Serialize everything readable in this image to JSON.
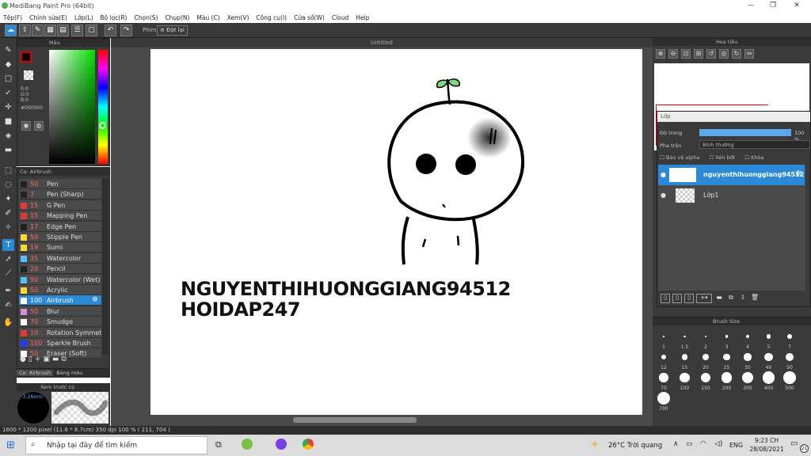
{
  "window": {
    "title": "MediBang Paint Pro (64bit)"
  },
  "menu": [
    "Tệp(F)",
    "Chỉnh sửa(E)",
    "Lớp(L)",
    "Bộ lọc(R)",
    "Chọn(S)",
    "Chụp(N)",
    "Màu (C)",
    "Xem(V)",
    "Công cụ(I)",
    "Cửa sổ(W)",
    "Cloud",
    "Help"
  ],
  "toolbar": {
    "filter_label": "Phím",
    "reset_label": "Đặt lại"
  },
  "color_panel": {
    "title": "Màu",
    "r": "R:0",
    "g": "G:0",
    "b": "B:0",
    "hex": "#000000"
  },
  "brush_panel": {
    "title": "Cọ: Airbrush",
    "items": [
      {
        "size": "50",
        "name": "Pen",
        "color": "#222222"
      },
      {
        "size": "7",
        "name": "Pen (Sharp)",
        "color": "#222222"
      },
      {
        "size": "15",
        "name": "G Pen",
        "color": "#e53935"
      },
      {
        "size": "15",
        "name": "Mapping Pen",
        "color": "#e53935"
      },
      {
        "size": "17",
        "name": "Edge Pen",
        "color": "#222222"
      },
      {
        "size": "50",
        "name": "Stipple Pen",
        "color": "#fdd835"
      },
      {
        "size": "19",
        "name": "Sumi",
        "color": "#fdd835"
      },
      {
        "size": "35",
        "name": "Watercolor",
        "color": "#4fc3f7"
      },
      {
        "size": "20",
        "name": "Pencil",
        "color": "#222222"
      },
      {
        "size": "90",
        "name": "Watercolor (Wet)",
        "color": "#4fc3f7"
      },
      {
        "size": "50",
        "name": "Acrylic",
        "color": "#fdd835"
      },
      {
        "size": "100",
        "name": "Airbrush",
        "color": "#ffffff"
      },
      {
        "size": "50",
        "name": "Blur",
        "color": "#ce93d8"
      },
      {
        "size": "70",
        "name": "Smudge",
        "color": "#ffffff"
      },
      {
        "size": "10",
        "name": "Rotation Symmetry",
        "color": "#e53935"
      },
      {
        "size": "100",
        "name": "Sparkle Brush",
        "color": "#1e3cff"
      },
      {
        "size": "50",
        "name": "Eraser (Soft)",
        "color": "#ffffff"
      }
    ],
    "tab1": "Cọ: Airbrush",
    "tab2": "Bảng màu"
  },
  "preview_panel": {
    "title": "Xem trước cọ",
    "size_label": "2.26mm"
  },
  "document": {
    "tab_title": "Untitled",
    "caption_line1": "NGUYENTHIHUONGGIANG94512",
    "caption_line2": "HOIDAP247"
  },
  "navigator": {
    "title": "Hoa tiêu"
  },
  "layer_panel": {
    "title": "Lớp",
    "opacity_label": "Độ trong",
    "opacity_value": "100 %",
    "blend_label": "Pha trộn",
    "blend_value": "Bình thường",
    "protect_alpha": "Bảo vệ alpha",
    "clipping": "Xén bớt",
    "lock": "Khóa",
    "layers": [
      {
        "name": "nguyenthihuonggiang94512",
        "selected": true
      },
      {
        "name": "Lớp1",
        "selected": false
      }
    ]
  },
  "brush_size_panel": {
    "title": "Brush Size",
    "sizes": [
      "1",
      "1.5",
      "2",
      "3",
      "4",
      "5",
      "7",
      "12",
      "15",
      "20",
      "25",
      "30",
      "40",
      "50",
      "70",
      "100",
      "150",
      "200",
      "300",
      "400",
      "500",
      "700"
    ]
  },
  "status": {
    "text": "1600 * 1200 pixel   (11.6 * 8.7cm)   350 dpi   100 %   ( 211, 704 )"
  },
  "taskbar": {
    "search_placeholder": "Nhập tại đây để tìm kiếm",
    "weather": "26°C  Trời quang",
    "lang": "ENG",
    "time": "9:23 CH",
    "date": "28/08/2021",
    "notif": "21"
  }
}
